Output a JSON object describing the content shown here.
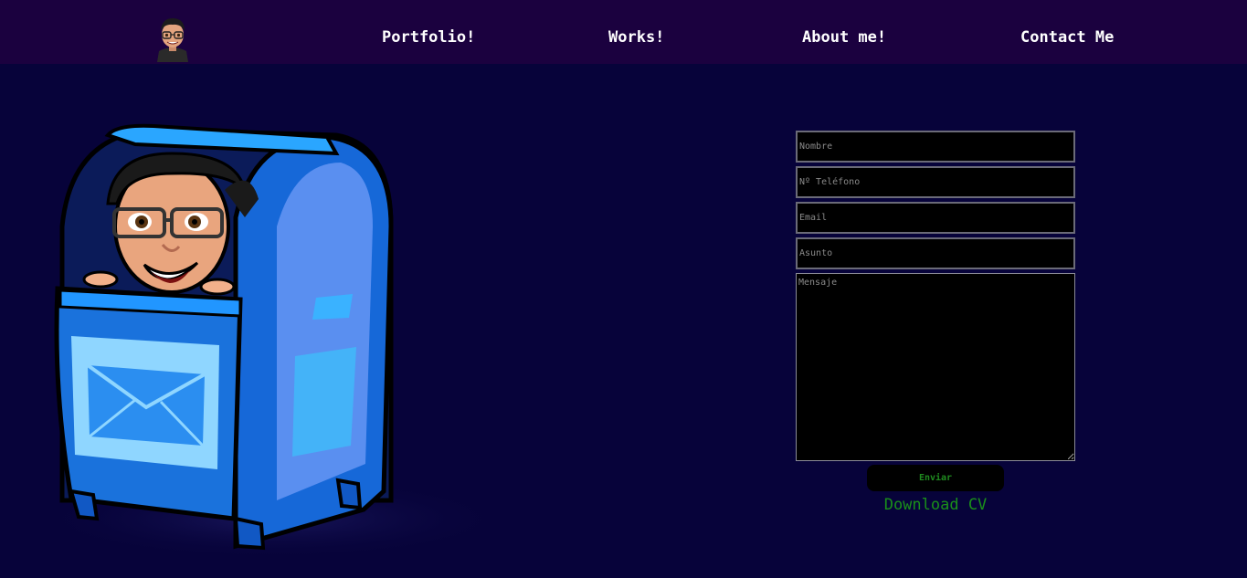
{
  "nav": {
    "items": [
      {
        "label": "Portfolio!"
      },
      {
        "label": "Works!"
      },
      {
        "label": "About me!"
      },
      {
        "label": "Contact Me"
      }
    ]
  },
  "form": {
    "name_placeholder": "Nombre",
    "phone_placeholder": "Nº Teléfono",
    "email_placeholder": "Email",
    "subject_placeholder": "Asunto",
    "message_placeholder": "Mensaje",
    "submit_label": "Enviar"
  },
  "download_cv_label": "Download CV",
  "colors": {
    "navbar_bg": "#1b013f",
    "page_bg": "#07033a",
    "accent_green": "#1a8f1a",
    "mailbox_blue": "#1f86e6"
  },
  "icons": {
    "nav_avatar": "avatar-icon",
    "hero_image": "mailbox-illustration"
  }
}
